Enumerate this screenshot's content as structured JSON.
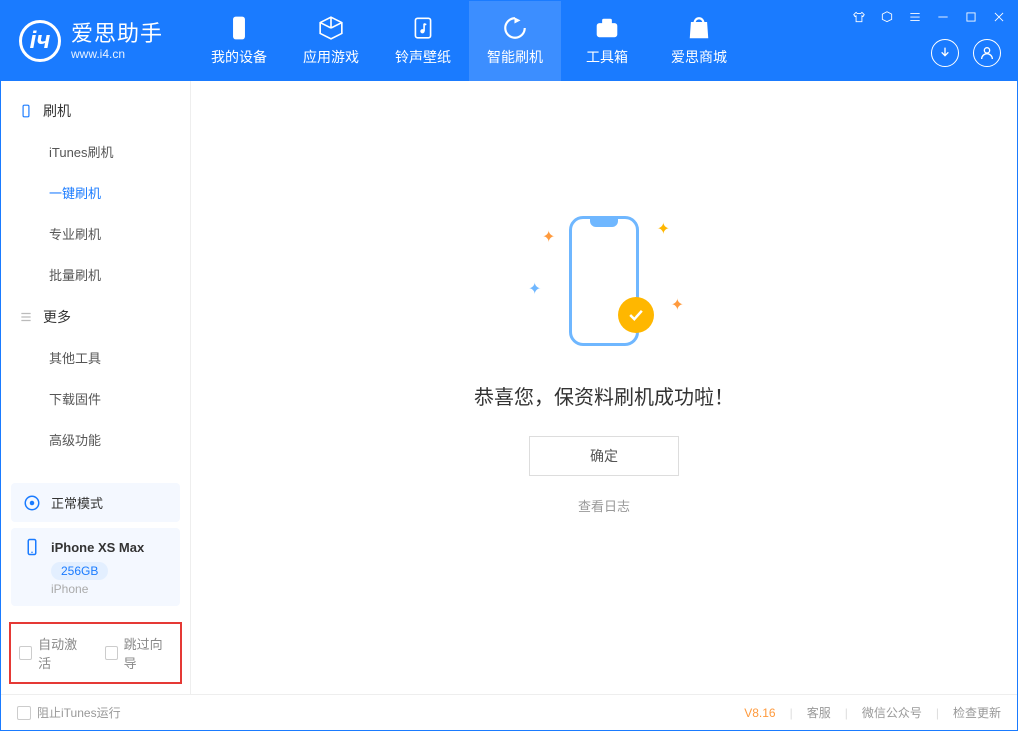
{
  "brand": {
    "name": "爱思助手",
    "url": "www.i4.cn"
  },
  "nav": [
    {
      "label": "我的设备"
    },
    {
      "label": "应用游戏"
    },
    {
      "label": "铃声壁纸"
    },
    {
      "label": "智能刷机"
    },
    {
      "label": "工具箱"
    },
    {
      "label": "爱思商城"
    }
  ],
  "sidebar": {
    "section1_title": "刷机",
    "items1": [
      {
        "label": "iTunes刷机"
      },
      {
        "label": "一键刷机"
      },
      {
        "label": "专业刷机"
      },
      {
        "label": "批量刷机"
      }
    ],
    "section2_title": "更多",
    "items2": [
      {
        "label": "其他工具"
      },
      {
        "label": "下载固件"
      },
      {
        "label": "高级功能"
      }
    ],
    "mode": "正常模式",
    "device": {
      "name": "iPhone XS Max",
      "storage": "256GB",
      "type": "iPhone"
    },
    "options": {
      "auto_activate": "自动激活",
      "skip_guide": "跳过向导"
    }
  },
  "main": {
    "success_text": "恭喜您，保资料刷机成功啦！",
    "ok_btn": "确定",
    "log_link": "查看日志"
  },
  "footer": {
    "block_itunes": "阻止iTunes运行",
    "version": "V8.16",
    "links": [
      "客服",
      "微信公众号",
      "检查更新"
    ]
  }
}
